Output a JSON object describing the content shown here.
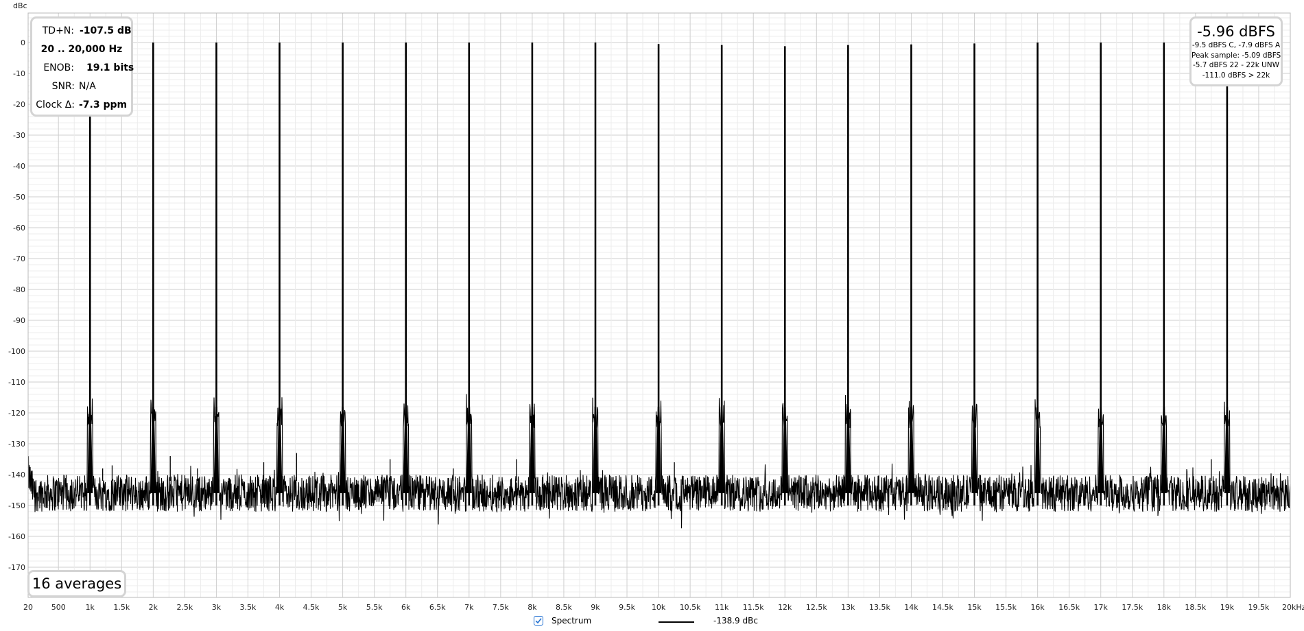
{
  "chart_data": {
    "type": "line",
    "ylabel": "dBc",
    "xlabel": "",
    "x_unit_label": "20kHz",
    "xlim": [
      20,
      20000
    ],
    "ylim": [
      -180,
      10
    ],
    "x_ticks": [
      {
        "value": 20,
        "label": "20"
      },
      {
        "value": 500,
        "label": "500"
      },
      {
        "value": 1000,
        "label": "1k"
      },
      {
        "value": 1500,
        "label": "1.5k"
      },
      {
        "value": 2000,
        "label": "2k"
      },
      {
        "value": 2500,
        "label": "2.5k"
      },
      {
        "value": 3000,
        "label": "3k"
      },
      {
        "value": 3500,
        "label": "3.5k"
      },
      {
        "value": 4000,
        "label": "4k"
      },
      {
        "value": 4500,
        "label": "4.5k"
      },
      {
        "value": 5000,
        "label": "5k"
      },
      {
        "value": 5500,
        "label": "5.5k"
      },
      {
        "value": 6000,
        "label": "6k"
      },
      {
        "value": 6500,
        "label": "6.5k"
      },
      {
        "value": 7000,
        "label": "7k"
      },
      {
        "value": 7500,
        "label": "7.5k"
      },
      {
        "value": 8000,
        "label": "8k"
      },
      {
        "value": 8500,
        "label": "8.5k"
      },
      {
        "value": 9000,
        "label": "9k"
      },
      {
        "value": 9500,
        "label": "9.5k"
      },
      {
        "value": 10000,
        "label": "10k"
      },
      {
        "value": 10500,
        "label": "10.5k"
      },
      {
        "value": 11000,
        "label": "11k"
      },
      {
        "value": 11500,
        "label": "11.5k"
      },
      {
        "value": 12000,
        "label": "12k"
      },
      {
        "value": 12500,
        "label": "12.5k"
      },
      {
        "value": 13000,
        "label": "13k"
      },
      {
        "value": 13500,
        "label": "13.5k"
      },
      {
        "value": 14000,
        "label": "14k"
      },
      {
        "value": 14500,
        "label": "14.5k"
      },
      {
        "value": 15000,
        "label": "15k"
      },
      {
        "value": 15500,
        "label": "15.5k"
      },
      {
        "value": 16000,
        "label": "16k"
      },
      {
        "value": 16500,
        "label": "16.5k"
      },
      {
        "value": 17000,
        "label": "17k"
      },
      {
        "value": 17500,
        "label": "17.5k"
      },
      {
        "value": 18000,
        "label": "18k"
      },
      {
        "value": 18500,
        "label": "18.5k"
      },
      {
        "value": 19000,
        "label": "19k"
      },
      {
        "value": 19500,
        "label": "19.5k"
      }
    ],
    "y_ticks": [
      {
        "value": 0,
        "label": "0"
      },
      {
        "value": -10,
        "label": "-10"
      },
      {
        "value": -20,
        "label": "-20"
      },
      {
        "value": -30,
        "label": "-30"
      },
      {
        "value": -40,
        "label": "-40"
      },
      {
        "value": -50,
        "label": "-50"
      },
      {
        "value": -60,
        "label": "-60"
      },
      {
        "value": -70,
        "label": "-70"
      },
      {
        "value": -80,
        "label": "-80"
      },
      {
        "value": -90,
        "label": "-90"
      },
      {
        "value": -100,
        "label": "-100"
      },
      {
        "value": -110,
        "label": "-110"
      },
      {
        "value": -120,
        "label": "-120"
      },
      {
        "value": -130,
        "label": "-130"
      },
      {
        "value": -140,
        "label": "-140"
      },
      {
        "value": -150,
        "label": "-150"
      },
      {
        "value": -160,
        "label": "-160"
      },
      {
        "value": -170,
        "label": "-170"
      }
    ],
    "grid": true,
    "minor_grid_y_step": 2,
    "series": [
      {
        "name": "Spectrum",
        "color": "#000000",
        "noise_floor_band": [
          -152,
          -140
        ],
        "peaks": [
          {
            "x": 1000,
            "y": 0
          },
          {
            "x": 2000,
            "y": 0
          },
          {
            "x": 3000,
            "y": 0
          },
          {
            "x": 4000,
            "y": 0
          },
          {
            "x": 5000,
            "y": 0
          },
          {
            "x": 6000,
            "y": 0
          },
          {
            "x": 7000,
            "y": 0
          },
          {
            "x": 8000,
            "y": 0
          },
          {
            "x": 9000,
            "y": 0
          },
          {
            "x": 10000,
            "y": -0.5
          },
          {
            "x": 11000,
            "y": -0.8
          },
          {
            "x": 12000,
            "y": -1.2
          },
          {
            "x": 13000,
            "y": -0.8
          },
          {
            "x": 14000,
            "y": -0.6
          },
          {
            "x": 15000,
            "y": -0.3
          },
          {
            "x": 16000,
            "y": 0
          },
          {
            "x": 17000,
            "y": 0
          },
          {
            "x": 18000,
            "y": 0
          },
          {
            "x": 19000,
            "y": 0
          }
        ],
        "spurs": [
          {
            "x": 1200,
            "y": -138
          },
          {
            "x": 1350,
            "y": -137
          },
          {
            "x": 2270,
            "y": -134
          },
          {
            "x": 2700,
            "y": -138
          },
          {
            "x": 3750,
            "y": -136
          },
          {
            "x": 4270,
            "y": -133
          },
          {
            "x": 5750,
            "y": -135
          },
          {
            "x": 6750,
            "y": -138
          },
          {
            "x": 7750,
            "y": -135
          },
          {
            "x": 10250,
            "y": -136
          },
          {
            "x": 18750,
            "y": -135
          }
        ]
      }
    ]
  },
  "tdn_panel": {
    "tdn_label": "TD+N:",
    "tdn_value": "-107.5 dB",
    "range": "20 .. 20,000 Hz",
    "enob_label": "ENOB:",
    "enob_value": "19.1 bits",
    "snr_label": "SNR:",
    "snr_value": "N/A",
    "clock_label": "Clock Δ:",
    "clock_value": "-7.3 ppm"
  },
  "level_panel": {
    "main": "-5.96 dBFS",
    "line1": "-9.5 dBFS C, -7.9 dBFS A",
    "line2": "Peak sample: -5.09 dBFS",
    "line3": "-5.7 dBFS 22 - 22k UNW",
    "line4": "-111.0 dBFS > 22k"
  },
  "averages": {
    "label": "16 averages"
  },
  "legend": {
    "series_label": "Spectrum",
    "checked": true,
    "value": "-138.9 dBc",
    "checkbox_color": "#1f6fd1"
  }
}
